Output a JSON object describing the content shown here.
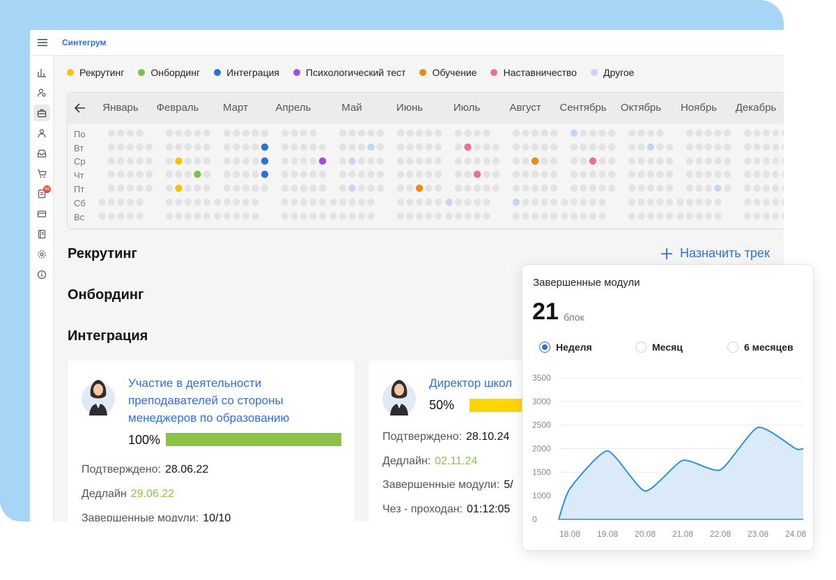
{
  "app": {
    "brand": "Синтегрум"
  },
  "legend": [
    {
      "label": "Рекрутинг",
      "color": "#f4c20d"
    },
    {
      "label": "Онбординг",
      "color": "#7cc143"
    },
    {
      "label": "Интеграция",
      "color": "#2f6fd6"
    },
    {
      "label": "Психологический тест",
      "color": "#a050d8"
    },
    {
      "label": "Обучение",
      "color": "#e8891a"
    },
    {
      "label": "Наставничество",
      "color": "#ee6f96"
    },
    {
      "label": "Другое",
      "color": "#c6d5f3"
    }
  ],
  "calendar": {
    "months": [
      "Январь",
      "Февраль",
      "Март",
      "Апрель",
      "Май",
      "Июнь",
      "Июль",
      "Август",
      "Сентябрь",
      "Октябрь",
      "Ноябрь",
      "Декабрь"
    ],
    "days": [
      "По",
      "Вт",
      "Ср",
      "Чт",
      "Пт",
      "Сб",
      "Вс"
    ],
    "empty_color": "#e3e3e3"
  },
  "sections": {
    "recruiting": "Рекрутинг",
    "onboarding": "Онбординг",
    "integration": "Интеграция"
  },
  "assign_label": "Назначить трек",
  "cards": [
    {
      "title": "Участие в деятельности преподавателей со стороны менеджеров по образованию",
      "percent_label": "100%",
      "progress": 1.0,
      "bar_color": "#8dc24a",
      "confirmed_label": "Подтверждено:",
      "confirmed_value": "28.06.22",
      "deadline_label": "Дедлайн",
      "deadline_value": "29.06.22",
      "modules_label": "Завершенные модули:",
      "modules_value": "10/10"
    },
    {
      "title": "Директор школ",
      "percent_label": "50%",
      "progress": 0.5,
      "bar_color": "#ffd400",
      "confirmed_label": "Подтверждено:",
      "confirmed_value": "28.10.24",
      "deadline_label": "Дедлайн:",
      "deadline_value": "02.11.24",
      "modules_label": "Завершенные модули:",
      "modules_value": "5/",
      "time_label": "Чез - проходан:",
      "time_value": "01:12:05"
    }
  ],
  "popup": {
    "title": "Завершенные модули",
    "count": "21",
    "unit": "блок",
    "options": [
      {
        "label": "Неделя",
        "selected": true
      },
      {
        "label": "Месяц",
        "selected": false
      },
      {
        "label": "6 месяцев",
        "selected": false
      }
    ]
  },
  "chart_data": {
    "type": "area",
    "x": [
      "18.08",
      "19.08",
      "20.08",
      "21.08",
      "22.08",
      "23.08",
      "24.08"
    ],
    "values": [
      1150,
      1950,
      1100,
      1750,
      1550,
      2450,
      2000
    ],
    "ylim": [
      0,
      3500
    ],
    "yticks": [
      "0",
      "1000",
      "1500",
      "2000",
      "2500",
      "3000",
      "3500"
    ],
    "grid": true,
    "color": "#2f8fd6"
  }
}
